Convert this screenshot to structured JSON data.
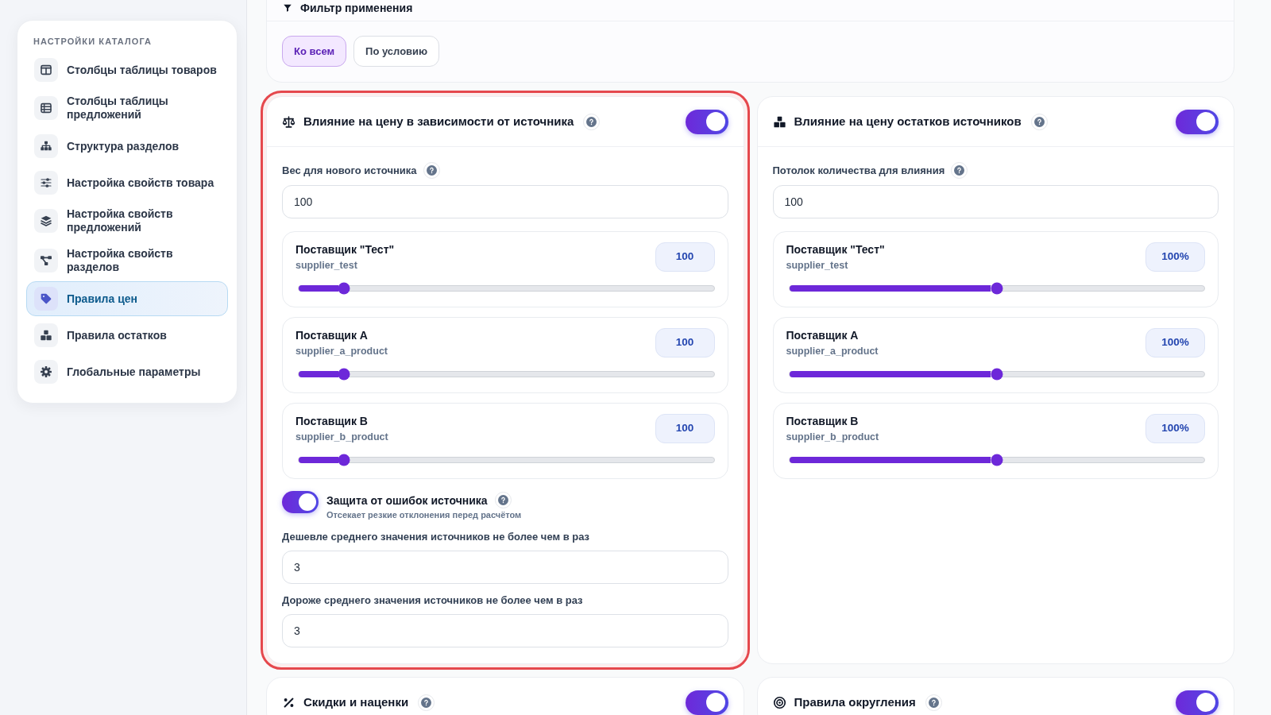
{
  "sidebar": {
    "heading": "НАСТРОЙКИ КАТАЛОГА",
    "items": [
      {
        "label": "Столбцы таблицы товаров",
        "selected": false
      },
      {
        "label": "Столбцы таблицы предложений",
        "selected": false
      },
      {
        "label": "Структура разделов",
        "selected": false
      },
      {
        "label": "Настройка свойств товара",
        "selected": false
      },
      {
        "label": "Настройка свойств предложений",
        "selected": false
      },
      {
        "label": "Настройка свойств разделов",
        "selected": false
      },
      {
        "label": "Правила цен",
        "selected": true
      },
      {
        "label": "Правила остатков",
        "selected": false
      },
      {
        "label": "Глобальные параметры",
        "selected": false
      }
    ]
  },
  "filter": {
    "title": "Фильтр применения",
    "options": [
      {
        "label": "Ко всем",
        "selected": true
      },
      {
        "label": "По условию",
        "selected": false
      }
    ]
  },
  "cards": [
    {
      "title": "Влияние на цену в зависимости от источника",
      "on": true,
      "highlighted": true,
      "field": {
        "label": "Вес для нового источника",
        "value": "100"
      },
      "sources": [
        {
          "name": "Поставщик \"Тест\"",
          "code": "supplier_test",
          "reading": "100",
          "level": 0.11
        },
        {
          "name": "Поставщик A",
          "code": "supplier_a_product",
          "reading": "100",
          "level": 0.11
        },
        {
          "name": "Поставщик B",
          "code": "supplier_b_product",
          "reading": "100",
          "level": 0.11
        }
      ],
      "protection": {
        "label": "Защита от ошибок источника",
        "hint": "Отсекает резкие отклонения перед расчётом",
        "on": true
      },
      "limits": [
        {
          "label": "Дешевле среднего значения источников не более чем в раз",
          "value": "3"
        },
        {
          "label": "Дороже среднего значения источников не более чем в раз",
          "value": "3"
        }
      ]
    },
    {
      "title": "Влияние на цену остатков источников",
      "on": true,
      "highlighted": false,
      "field": {
        "label": "Потолок количества для влияния",
        "value": "100"
      },
      "sources": [
        {
          "name": "Поставщик \"Тест\"",
          "code": "supplier_test",
          "reading": "100%",
          "level": 0.5
        },
        {
          "name": "Поставщик A",
          "code": "supplier_a_product",
          "reading": "100%",
          "level": 0.5
        },
        {
          "name": "Поставщик B",
          "code": "supplier_b_product",
          "reading": "100%",
          "level": 0.5
        }
      ]
    },
    {
      "title": "Скидки и наценки",
      "on": true,
      "highlighted": false
    },
    {
      "title": "Правила округления",
      "on": true,
      "highlighted": false
    }
  ]
}
